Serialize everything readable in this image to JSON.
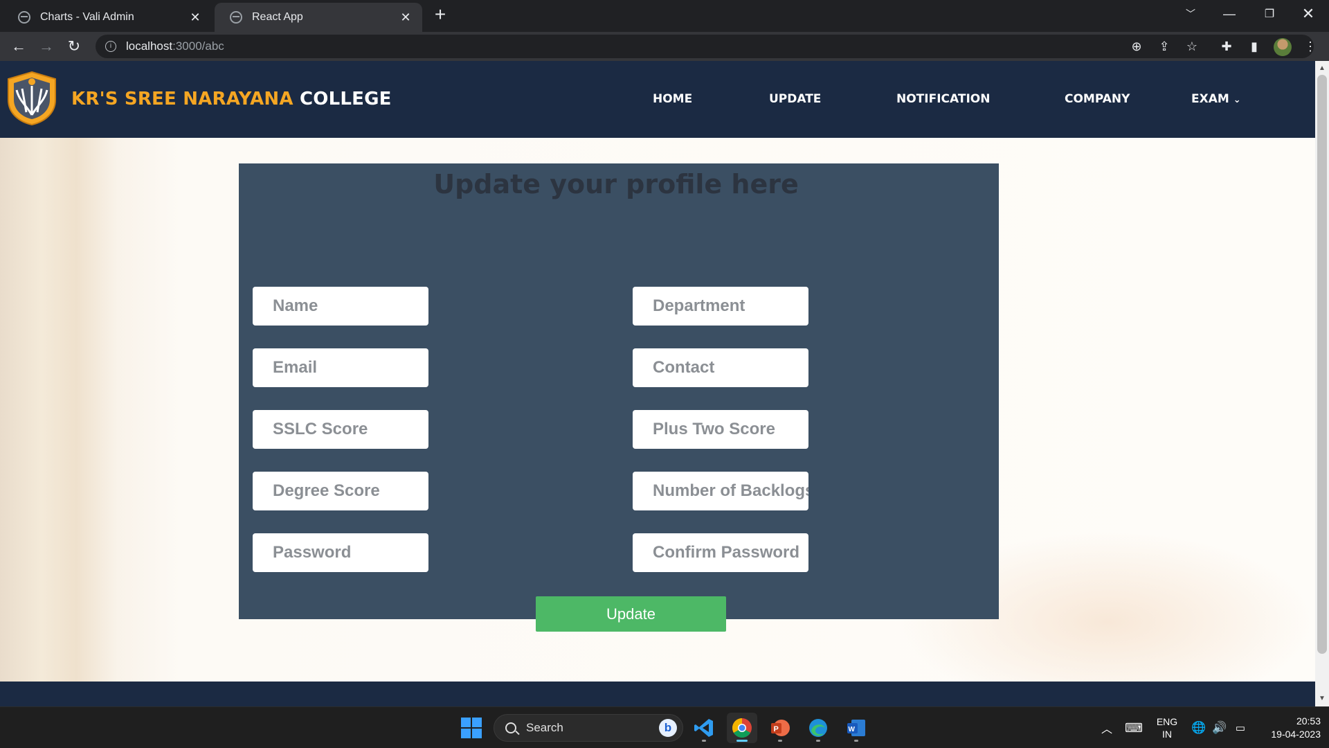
{
  "browser": {
    "tabs": [
      {
        "title": "Charts - Vali Admin",
        "active": false
      },
      {
        "title": "React App",
        "active": true
      }
    ],
    "url_host": "localhost",
    "url_path": ":3000/abc"
  },
  "site": {
    "brand_highlight": "KR'S SREE NARAYANA",
    "brand_rest": "COLLEGE",
    "nav": [
      "HOME",
      "UPDATE",
      "NOTIFICATION",
      "COMPANY",
      "EXAM"
    ],
    "colors": {
      "navbar": "#1b2a43",
      "brand_accent": "#f5a623",
      "card": "#3b4f63",
      "button": "#4db866"
    }
  },
  "form": {
    "title": "Update your profile here",
    "fields": {
      "name": "Name",
      "department": "Department",
      "email": "Email",
      "contact": "Contact",
      "sslc": "SSLC Score",
      "plus_two": "Plus Two Score",
      "degree": "Degree Score",
      "backlogs": "Number of Backlogs",
      "password": "Password",
      "confirm_password": "Confirm Password"
    },
    "submit_label": "Update"
  },
  "taskbar": {
    "search_label": "Search",
    "bing_label": "b",
    "language": "ENG",
    "region": "IN",
    "time": "20:53",
    "date": "19-04-2023"
  }
}
